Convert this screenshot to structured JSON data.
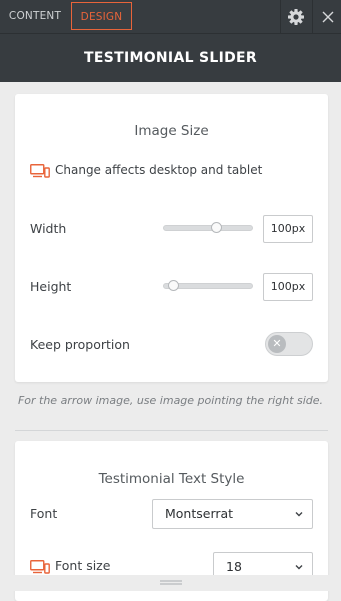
{
  "tabs": {
    "content": "CONTENT",
    "design": "DESIGN"
  },
  "header": {
    "title": "TESTIMONIAL SLIDER"
  },
  "image_size": {
    "title": "Image Size",
    "device_note": "Change affects desktop and tablet",
    "width_label": "Width",
    "width_value": "100px",
    "width_slider_fraction": 0.6,
    "height_label": "Height",
    "height_value": "100px",
    "height_slider_fraction": 0.05,
    "keep_proportion_label": "Keep proportion",
    "keep_proportion_on": false
  },
  "hint": "For the arrow image, use image pointing the right side.",
  "text_style": {
    "title": "Testimonial Text Style",
    "font_label": "Font",
    "font_value": "Montserrat",
    "font_size_label": "Font size",
    "font_size_value": "18"
  },
  "colors": {
    "accent": "#e8643a",
    "topbar": "#373c40",
    "panel": "#ffffff",
    "background": "#ececec"
  },
  "icons": [
    "gear-icon",
    "close-icon",
    "devices-icon",
    "chevron-down-icon",
    "drag-handle-icon"
  ]
}
